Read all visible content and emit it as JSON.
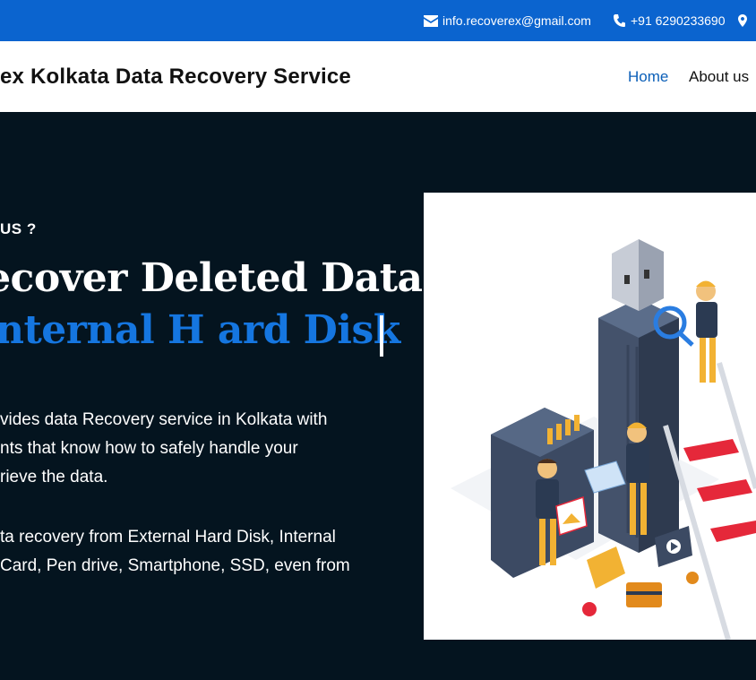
{
  "topbar": {
    "email": "info.recoverex@gmail.com",
    "phone": "+91 6290233690",
    "icons": [
      "envelope-icon",
      "phone-icon",
      "map-pin-icon"
    ]
  },
  "header": {
    "site_title": "ex Kolkata Data Recovery Service",
    "nav": [
      {
        "label": "Home",
        "active": true
      },
      {
        "label": "About us",
        "active": false
      }
    ]
  },
  "hero": {
    "eyebrow": "US ?",
    "headline_line1": "Recover Deleted Data",
    "headline_line2": "m Internal H ard Disk",
    "para1": [
      "vides data Recovery service in Kolkata with",
      "nts that know how to safely handle your",
      "rieve the data."
    ],
    "para2": [
      "ta recovery from External Hard Disk, Internal",
      "Card, Pen drive, Smartphone, SSD, even from"
    ]
  },
  "colors": {
    "topbar": "#0b64cf",
    "hero_bg": "#04141f",
    "accent_blue": "#1576e0",
    "nav_active": "#0b5fb8"
  }
}
